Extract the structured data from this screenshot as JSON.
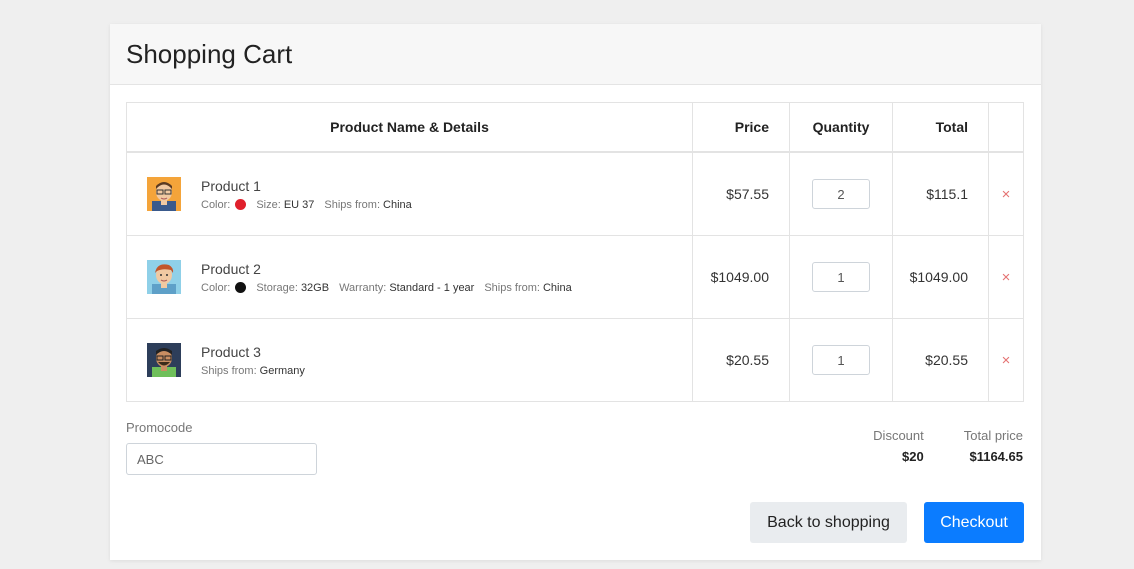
{
  "card": {
    "title": "Shopping Cart"
  },
  "table": {
    "headers": {
      "name": "Product Name & Details",
      "price": "Price",
      "quantity": "Quantity",
      "total": "Total"
    },
    "rows": [
      {
        "name": "Product 1",
        "color_label": "Color:",
        "color_value": "#e0202c",
        "details": [
          {
            "k": "Size:",
            "v": "EU 37"
          },
          {
            "k": "Ships from:",
            "v": "China"
          }
        ],
        "price": "$57.55",
        "quantity": "2",
        "total": "$115.1",
        "remove": "×"
      },
      {
        "name": "Product 2",
        "color_label": "Color:",
        "color_value": "#111111",
        "details": [
          {
            "k": "Storage:",
            "v": "32GB"
          },
          {
            "k": "Warranty:",
            "v": "Standard - 1 year"
          },
          {
            "k": "Ships from:",
            "v": "China"
          }
        ],
        "price": "$1049.00",
        "quantity": "1",
        "total": "$1049.00",
        "remove": "×"
      },
      {
        "name": "Product 3",
        "details": [
          {
            "k": "Ships from:",
            "v": "Germany"
          }
        ],
        "price": "$20.55",
        "quantity": "1",
        "total": "$20.55",
        "remove": "×"
      }
    ]
  },
  "promo": {
    "label": "Promocode",
    "value": "ABC"
  },
  "summary": {
    "discount_label": "Discount",
    "discount_value": "$20",
    "total_label": "Total price",
    "total_value": "$1164.65"
  },
  "buttons": {
    "back": "Back to shopping",
    "checkout": "Checkout"
  },
  "colors": {
    "accent": "#0b7cff",
    "remove": "#e57373"
  },
  "icons": {
    "remove": "close-icon",
    "avatar": "avatar-icon"
  }
}
